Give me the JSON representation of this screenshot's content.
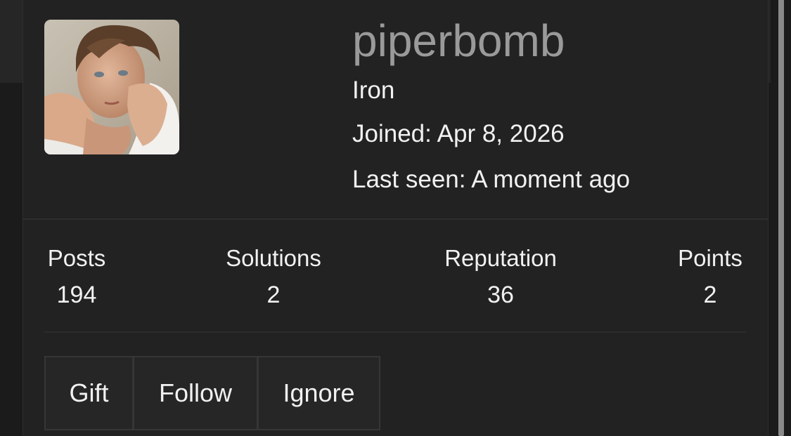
{
  "profile": {
    "username": "piperbomb",
    "rank": "Iron",
    "joined": "Joined: Apr 8, 2026",
    "last_seen": "Last seen: A moment ago",
    "avatar_icon": "user-avatar-photo"
  },
  "stats": [
    {
      "label": "Posts",
      "value": "194"
    },
    {
      "label": "Solutions",
      "value": "2"
    },
    {
      "label": "Reputation",
      "value": "36"
    },
    {
      "label": "Points",
      "value": "2"
    }
  ],
  "actions": {
    "gift": "Gift",
    "follow": "Follow",
    "ignore": "Ignore"
  },
  "colors": {
    "background": "#1b1b1b",
    "card": "#222222",
    "username": "#9a9a9a",
    "text": "#f1f1f1",
    "button": "#262626"
  }
}
